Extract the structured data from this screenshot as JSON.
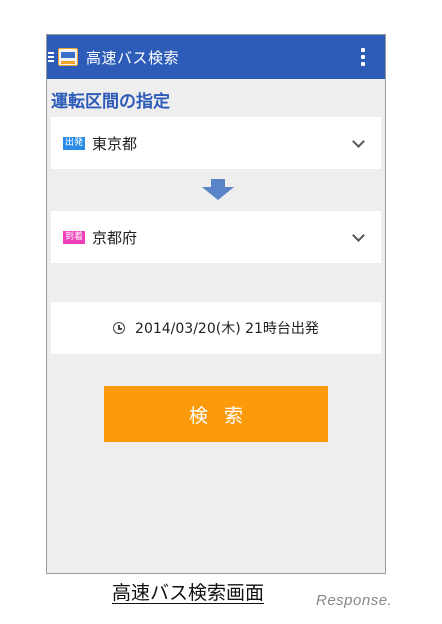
{
  "app": {
    "title": "高速バス検索",
    "icons": {
      "menu": "hamburger-icon",
      "logo": "bus-app-icon",
      "more": "overflow-menu-icon"
    }
  },
  "section": {
    "label": "運転区間の指定"
  },
  "departure": {
    "badge": "出発",
    "station": "東京都"
  },
  "arrival": {
    "badge": "到着",
    "station": "京都府"
  },
  "datetime": {
    "text": "2014/03/20(木) 21時台出発",
    "icon": "clock-icon"
  },
  "search_button": {
    "label": "検索"
  },
  "caption": "高速バス検索画面",
  "watermark": "Response.",
  "colors": {
    "appbar": "#2d5bb8",
    "section_label": "#2d5bb8",
    "depart_badge": "#2b8ce8",
    "arrive_badge": "#ee3fb8",
    "arrow": "#5b83c7",
    "search_button": "#fb9b0c",
    "screen_background": "#eeeeee"
  }
}
